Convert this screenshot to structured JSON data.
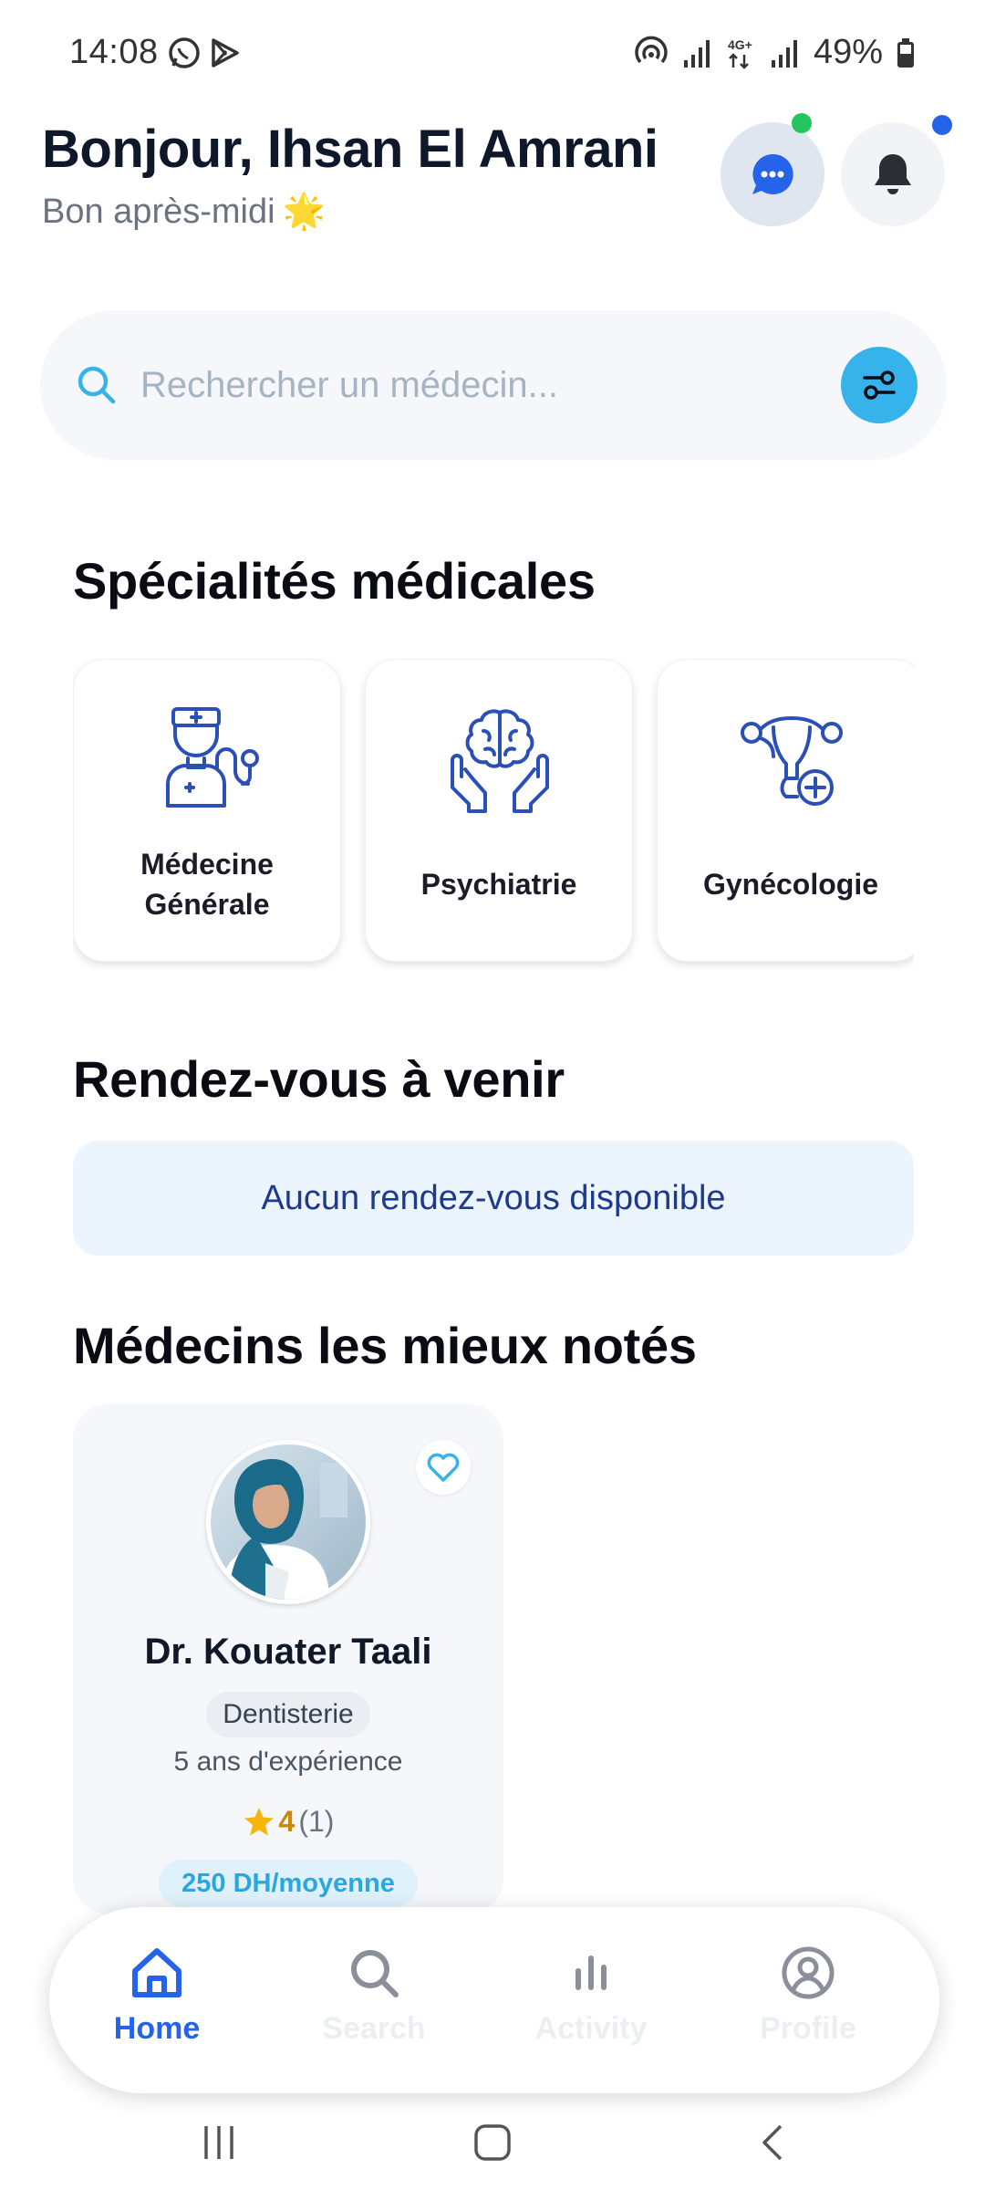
{
  "status_bar": {
    "time": "14:08",
    "battery": "49%",
    "icons": [
      "whatsapp-icon",
      "play-store-icon",
      "hotspot-icon",
      "signal-icon",
      "4g-icon",
      "battery-icon"
    ]
  },
  "header": {
    "greeting": "Bonjour, Ihsan El Amrani",
    "subgreeting": "Bon après-midi",
    "subgreeting_emoji": "🌟"
  },
  "search": {
    "placeholder": "Rechercher un médecin..."
  },
  "specialties": {
    "title": "Spécialités médicales",
    "items": [
      {
        "label": "Médecine Générale",
        "icon": "doctor-stethoscope-icon"
      },
      {
        "label": "Psychiatrie",
        "icon": "brain-hands-icon"
      },
      {
        "label": "Gynécologie",
        "icon": "uterus-cross-icon"
      }
    ]
  },
  "appointments": {
    "title": "Rendez-vous à venir",
    "empty_text": "Aucun rendez-vous disponible"
  },
  "top_doctors": {
    "title": "Médecins les mieux notés",
    "items": [
      {
        "name": "Dr. Kouater Taali",
        "specialty": "Dentisterie",
        "experience": "5 ans d'expérience",
        "rating": "4",
        "reviews": "(1)",
        "price": "250 DH/moyenne"
      }
    ]
  },
  "bottom_nav": {
    "items": [
      {
        "label": "Home",
        "icon": "home-icon",
        "active": true
      },
      {
        "label": "Search",
        "icon": "search-icon",
        "active": false
      },
      {
        "label": "Activity",
        "icon": "activity-icon",
        "active": false
      },
      {
        "label": "Profile",
        "icon": "profile-icon",
        "active": false
      }
    ]
  },
  "colors": {
    "primary": "#2563eb",
    "accent": "#36b3ea",
    "online_dot": "#22c55e",
    "notification_dot": "#2563eb"
  }
}
